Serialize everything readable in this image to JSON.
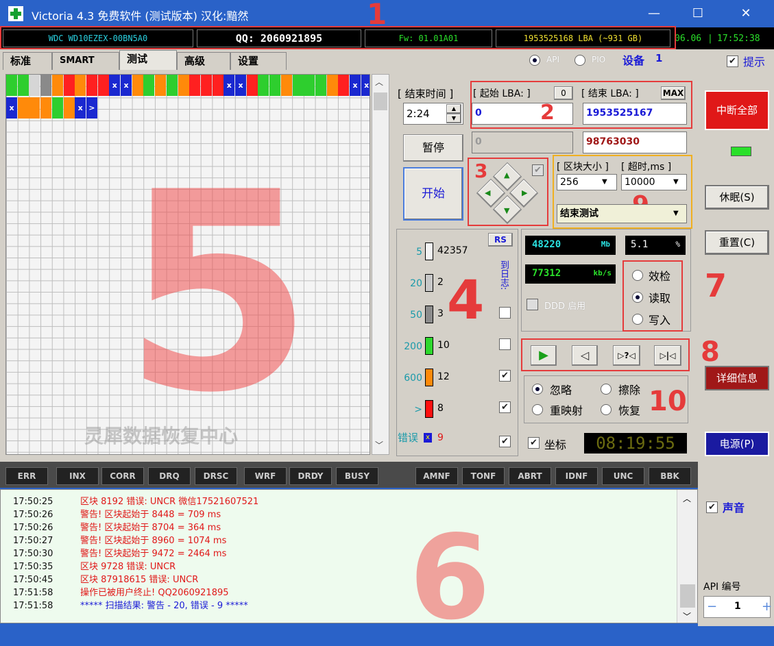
{
  "window": {
    "title": "Victoria 4.3 免费软件 (测试版本) 汉化:黯然",
    "min_glyph": "—",
    "max_glyph": "☐",
    "close_glyph": "✕"
  },
  "info_bar": {
    "model": "WDC WD10EZEX-00BN5A0",
    "qq": "QQ: 2060921895",
    "firmware": "Fw: 01.01A01",
    "lba": "1953525168 LBA (~931 GB)",
    "date": "06.06",
    "time": "17:52:38"
  },
  "tabs": [
    {
      "label": "标准"
    },
    {
      "label": "SMART"
    },
    {
      "label": "测试",
      "active": true
    },
    {
      "label": "高级"
    },
    {
      "label": "设置"
    }
  ],
  "mode": {
    "api_label": "API",
    "pio_label": "PIO",
    "device_label": "设备",
    "device_num": "1",
    "hint_label": "提示"
  },
  "annotations": [
    "1",
    "2",
    "3",
    "4",
    "5",
    "6",
    "7",
    "8",
    "9",
    "10"
  ],
  "grid": {
    "watermark": "灵犀数据恢复中心",
    "row1": [
      {
        "c": "#2ece2e"
      },
      {
        "c": "#2ece2e"
      },
      {
        "c": "#d6d6d6"
      },
      {
        "c": "#8a8a8a"
      },
      {
        "c": "#ff8a0a"
      },
      {
        "c": "#ff2020"
      },
      {
        "c": "#ff8a0a"
      },
      {
        "c": "#ff2020"
      },
      {
        "c": "#ff2020"
      },
      {
        "c": "#1a28d0",
        "t": "x"
      },
      {
        "c": "#1a28d0",
        "t": "x"
      },
      {
        "c": "#ff8a0a"
      },
      {
        "c": "#2ece2e"
      },
      {
        "c": "#ff8a0a"
      },
      {
        "c": "#2ece2e"
      },
      {
        "c": "#ff8a0a"
      },
      {
        "c": "#ff2020"
      },
      {
        "c": "#ff2020"
      },
      {
        "c": "#ff2020"
      },
      {
        "c": "#1a28d0",
        "t": "x"
      },
      {
        "c": "#1a28d0",
        "t": "x"
      },
      {
        "c": "#ff2020"
      },
      {
        "c": "#2ece2e"
      },
      {
        "c": "#2ece2e"
      },
      {
        "c": "#ff8a0a"
      },
      {
        "c": "#2ece2e"
      },
      {
        "c": "#2ece2e"
      },
      {
        "c": "#2ece2e"
      },
      {
        "c": "#ff8a0a"
      },
      {
        "c": "#ff2020"
      },
      {
        "c": "#1a28d0",
        "t": "x"
      },
      {
        "c": "#1a28d0",
        "t": "x"
      }
    ],
    "row2": [
      {
        "c": "#1a28d0",
        "t": "x"
      },
      {
        "c": "#ff8a0a"
      },
      {
        "c": "#ff8a0a"
      },
      {
        "c": "#ff8a0a"
      },
      {
        "c": "#2ece2e"
      },
      {
        "c": "#ff8a0a"
      },
      {
        "c": "#1a28d0",
        "t": "x"
      },
      {
        "c": "#1a28d0",
        "t": ">"
      }
    ]
  },
  "test": {
    "end_time_label": "结束时间",
    "end_time": "2:24",
    "start_lba_label": "起始 LBA:",
    "start_lba_reset": "0",
    "end_lba_label": "结束 LBA:",
    "end_lba_max": "MAX",
    "start_lba": "0",
    "end_lba": "1953525167",
    "current_lba": "0",
    "current_block": "98763030",
    "pause_label": "暂停",
    "start_label": "开始",
    "block_size_label": "区块大小",
    "timeout_label": "超时,ms",
    "block_size": "256",
    "timeout": "10000",
    "end_action": "结束测试"
  },
  "legend": {
    "rs_label": "RS",
    "log_label": "到日志:",
    "rows": [
      {
        "ms": "5",
        "count": "42357",
        "color": "#f4f4f4"
      },
      {
        "ms": "20",
        "count": "2",
        "color": "#c8c8c8"
      },
      {
        "ms": "50",
        "count": "3",
        "color": "#8c8c8c"
      },
      {
        "ms": "200",
        "count": "10",
        "color": "#2ed82e"
      },
      {
        "ms": "600",
        "count": "12",
        "color": "#ff8a0a"
      },
      {
        "ms": ">",
        "count": "8",
        "color": "#ff1010"
      }
    ],
    "error_label": "错误",
    "error_count": "9"
  },
  "stats": {
    "mb": "48220",
    "mb_unit": "Mb",
    "percent": "5.1",
    "percent_unit": "%",
    "speed": "77312",
    "speed_unit": "kb/s",
    "ddd_label": "DDD 启用",
    "verify_label": "效检",
    "read_label": "读取",
    "write_label": "写入"
  },
  "actions": {
    "ignore_label": "忽略",
    "erase_label": "擦除",
    "remap_label": "重映射",
    "restore_label": "恢复",
    "coords_label": "坐标",
    "timer": "08:19:55"
  },
  "status_flags": [
    "ERR",
    "INX",
    "CORR",
    "DRQ",
    "DRSC",
    "WRF",
    "DRDY",
    "BUSY",
    "AMNF",
    "TONF",
    "ABRT",
    "IDNF",
    "UNC",
    "BBK"
  ],
  "side": {
    "break_all": "中断全部",
    "sleep": "休眠(S)",
    "reset": "重置(C)",
    "details": "详细信息",
    "power": "电源(P)",
    "sound_label": "声音",
    "api_num_label": "API 编号",
    "api_num": "1"
  },
  "log": [
    {
      "time": "17:50:25",
      "text": "区块 8192 错误: UNCR  微信17521607521",
      "color": "#e01818"
    },
    {
      "time": "17:50:26",
      "text": "警告! 区块起始于 8448 = 709 ms",
      "color": "#e01818"
    },
    {
      "time": "17:50:26",
      "text": "警告! 区块起始于 8704 = 364 ms",
      "color": "#e01818"
    },
    {
      "time": "17:50:27",
      "text": "警告! 区块起始于 8960 = 1074 ms",
      "color": "#e01818"
    },
    {
      "time": "17:50:30",
      "text": "警告! 区块起始于 9472 = 2464 ms",
      "color": "#e01818"
    },
    {
      "time": "17:50:35",
      "text": "区块 9728 错误: UNCR",
      "color": "#e01818"
    },
    {
      "time": "17:50:45",
      "text": "区块 87918615 错误: UNCR",
      "color": "#e01818"
    },
    {
      "time": "17:51:58",
      "text": "操作已被用户终止! QQ2060921895",
      "color": "#e01818"
    },
    {
      "time": "17:51:58",
      "text": "***** 扫描结果: 警告 - 20, 错误 - 9 *****",
      "color": "#1a1ad6"
    }
  ]
}
